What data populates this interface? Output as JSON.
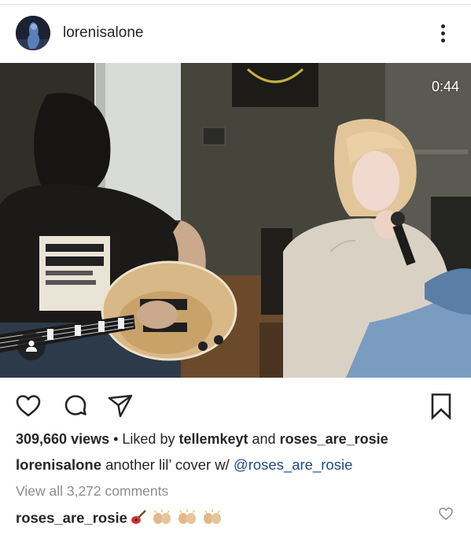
{
  "post": {
    "username": "lorenisalone",
    "timer": "0:44",
    "views_count": "309,660 views",
    "liked_by_prefix": " • Liked by ",
    "liked_by_user1": "tellemkeyt",
    "liked_by_and": " and ",
    "liked_by_user2": "roses_are_rosie",
    "caption_user": "lorenisalone",
    "caption_text": " another lil’ cover w/ ",
    "caption_mention": "@roses_are_rosie",
    "view_all_comments": "View all 3,272 comments",
    "comment_user": "roses_are_rosie"
  },
  "icons": {
    "more": "more-vertical-icon",
    "like": "heart-outline-icon",
    "comment": "comment-bubble-icon",
    "share": "paper-plane-icon",
    "save": "bookmark-icon",
    "tag": "person-tag-icon",
    "comment_like": "small-heart-icon"
  },
  "colors": {
    "text": "#262626",
    "muted": "#8e8e8e",
    "mention": "#1f4a86",
    "media_bg": "#2a2a26"
  }
}
